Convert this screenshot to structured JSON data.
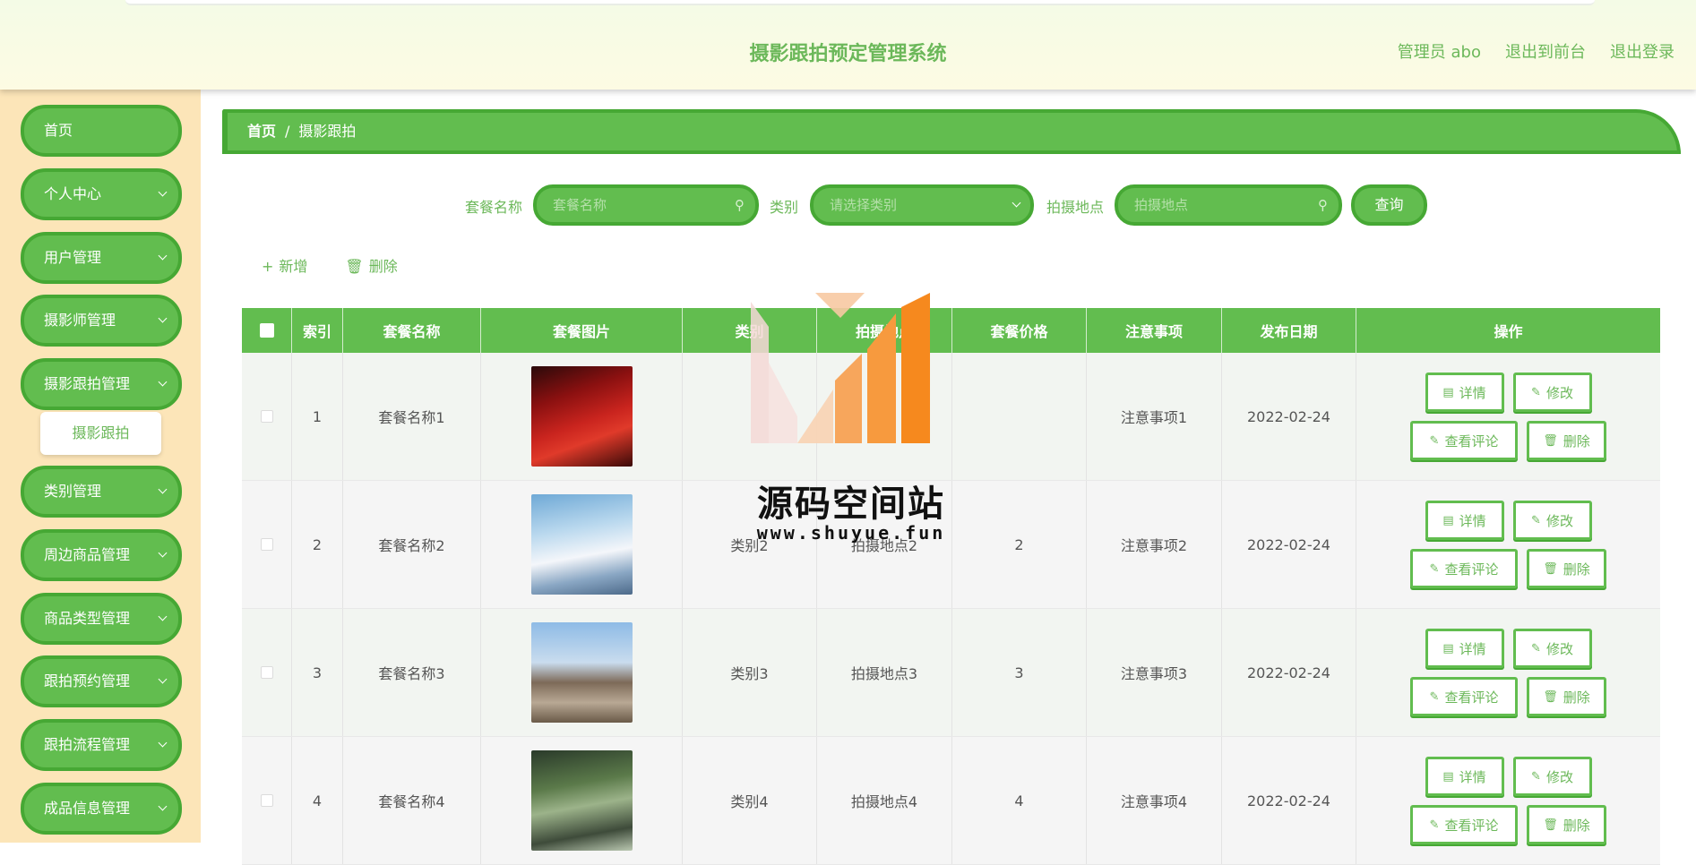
{
  "header": {
    "title": "摄影跟拍预定管理系统",
    "links": [
      "管理员 abo",
      "退出到前台",
      "退出登录"
    ]
  },
  "sidebar": {
    "items": [
      {
        "label": "首页",
        "expandable": false
      },
      {
        "label": "个人中心",
        "expandable": true
      },
      {
        "label": "用户管理",
        "expandable": true
      },
      {
        "label": "摄影师管理",
        "expandable": true
      },
      {
        "label": "摄影跟拍管理",
        "expandable": true
      },
      {
        "label": "类别管理",
        "expandable": true
      },
      {
        "label": "周边商品管理",
        "expandable": true
      },
      {
        "label": "商品类型管理",
        "expandable": true
      },
      {
        "label": "跟拍预约管理",
        "expandable": true
      },
      {
        "label": "跟拍流程管理",
        "expandable": true
      },
      {
        "label": "成品信息管理",
        "expandable": true
      }
    ],
    "active_sub": "摄影跟拍"
  },
  "breadcrumb": {
    "home": "首页",
    "separator": "/",
    "current": "摄影跟拍"
  },
  "search": {
    "package_label": "套餐名称",
    "package_placeholder": "套餐名称",
    "category_label": "类别",
    "category_placeholder": "请选择类别",
    "location_label": "拍摄地点",
    "location_placeholder": "拍摄地点",
    "query_button": "查询"
  },
  "toolbar": {
    "add_label": "新增",
    "delete_label": "删除"
  },
  "table": {
    "headers": [
      "索引",
      "套餐名称",
      "套餐图片",
      "类别",
      "拍摄地点",
      "套餐价格",
      "注意事项",
      "发布日期",
      "操作"
    ],
    "rows": [
      {
        "index": "1",
        "name": "套餐名称1",
        "category": "",
        "location": "",
        "price": "",
        "notes": "注意事项1",
        "date": "2022-02-24"
      },
      {
        "index": "2",
        "name": "套餐名称2",
        "category": "类别2",
        "location": "拍摄地点2",
        "price": "2",
        "notes": "注意事项2",
        "date": "2022-02-24"
      },
      {
        "index": "3",
        "name": "套餐名称3",
        "category": "类别3",
        "location": "拍摄地点3",
        "price": "3",
        "notes": "注意事项3",
        "date": "2022-02-24"
      },
      {
        "index": "4",
        "name": "套餐名称4",
        "category": "类别4",
        "location": "拍摄地点4",
        "price": "4",
        "notes": "注意事项4",
        "date": "2022-02-24"
      }
    ],
    "row_buttons": {
      "detail": "详情",
      "edit": "修改",
      "review": "查看评论",
      "delete": "删除"
    }
  },
  "watermark": {
    "text": "源码空间站",
    "url": "www.shuyue.fun"
  },
  "colors": {
    "primary": "#62bd4f",
    "primary_dark": "#46a834",
    "text_green": "#6cb85a",
    "sidebar_bg": "#fce5b8"
  }
}
